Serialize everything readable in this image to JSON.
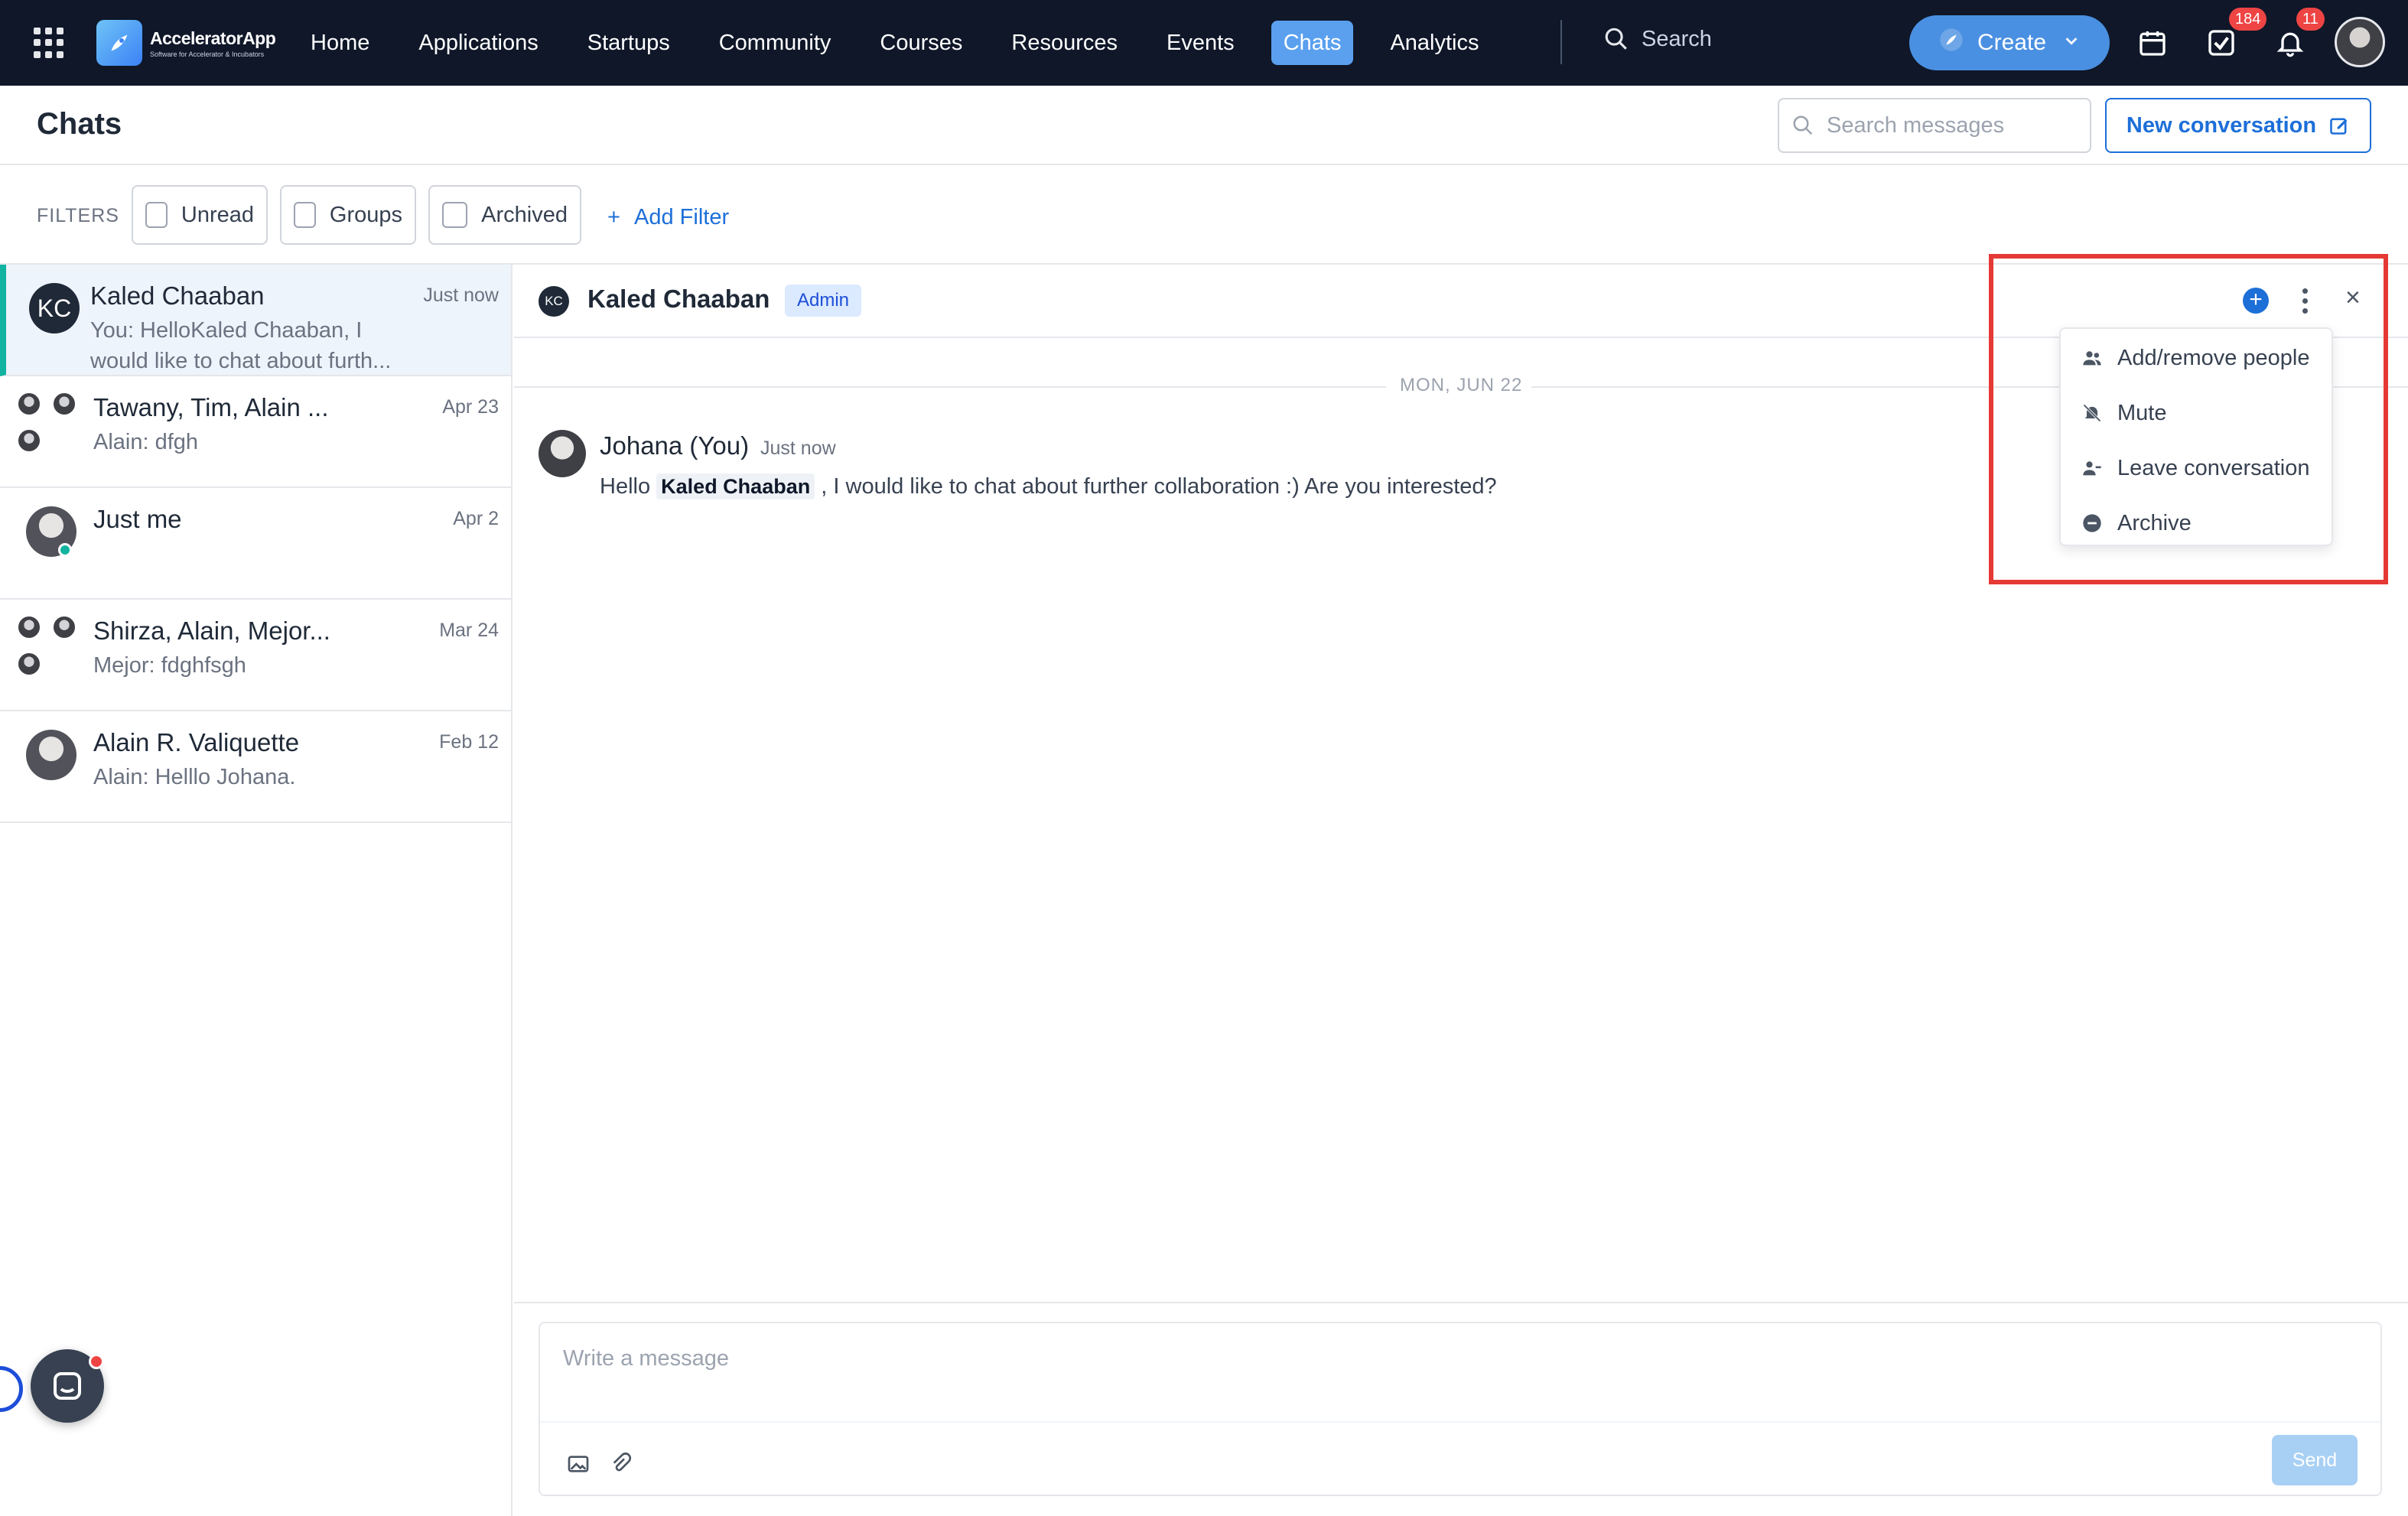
{
  "nav": {
    "logo_name": "AcceleratorApp",
    "logo_tagline": "Software for Accelerator & Incubators",
    "items": [
      {
        "label": "Home"
      },
      {
        "label": "Applications"
      },
      {
        "label": "Startups"
      },
      {
        "label": "Community"
      },
      {
        "label": "Courses"
      },
      {
        "label": "Resources"
      },
      {
        "label": "Events"
      },
      {
        "label": "Chats",
        "active": true
      },
      {
        "label": "Analytics"
      }
    ],
    "search_placeholder": "Search",
    "create_label": "Create",
    "tasks_badge": "184",
    "notifications_badge": "11"
  },
  "page": {
    "title": "Chats",
    "search_placeholder": "Search messages",
    "new_conversation_label": "New conversation"
  },
  "filters": {
    "label": "FILTERS",
    "chips": [
      {
        "label": "Unread"
      },
      {
        "label": "Groups"
      },
      {
        "label": "Archived"
      }
    ],
    "add_filter_label": "Add Filter"
  },
  "conversations": [
    {
      "name": "Kaled Chaaban",
      "date": "Just now",
      "preview": "You: HelloKaled Chaaban, I would like to chat about furth...",
      "avatar_initials": "KC",
      "active": true
    },
    {
      "name": "Tawany, Tim, Alain ...",
      "date": "Apr 23",
      "preview": "Alain: dfgh"
    },
    {
      "name": "Just me",
      "date": "Apr 2",
      "preview": ""
    },
    {
      "name": "Shirza, Alain, Mejor...",
      "date": "Mar 24",
      "preview": "Mejor: fdghfsgh"
    },
    {
      "name": "Alain R. Valiquette",
      "date": "Feb 12",
      "preview": "Alain: Helllo Johana."
    }
  ],
  "chat": {
    "avatar_initials": "KC",
    "name": "Kaled Chaaban",
    "role_badge": "Admin",
    "date_separator": "MON, JUN 22",
    "message": {
      "author": "Johana (You)",
      "time": "Just now",
      "text_before": "Hello ",
      "mention": "Kaled Chaaban",
      "text_after": " , I would like to chat about further collaboration :) Are you interested?"
    }
  },
  "menu": {
    "items": [
      {
        "label": "Add/remove people",
        "icon": "people-icon"
      },
      {
        "label": "Mute",
        "icon": "bell-off-icon"
      },
      {
        "label": "Leave conversation",
        "icon": "user-minus-icon"
      },
      {
        "label": "Archive",
        "icon": "archive-circle-icon"
      }
    ]
  },
  "composer": {
    "placeholder": "Write a message",
    "send_label": "Send"
  },
  "colors": {
    "nav_bg": "#0f1729",
    "accent": "#1d6fd8",
    "active_nav": "#5aa0ef",
    "active_conv_border": "#12b3a0",
    "highlight": "#e53935"
  }
}
